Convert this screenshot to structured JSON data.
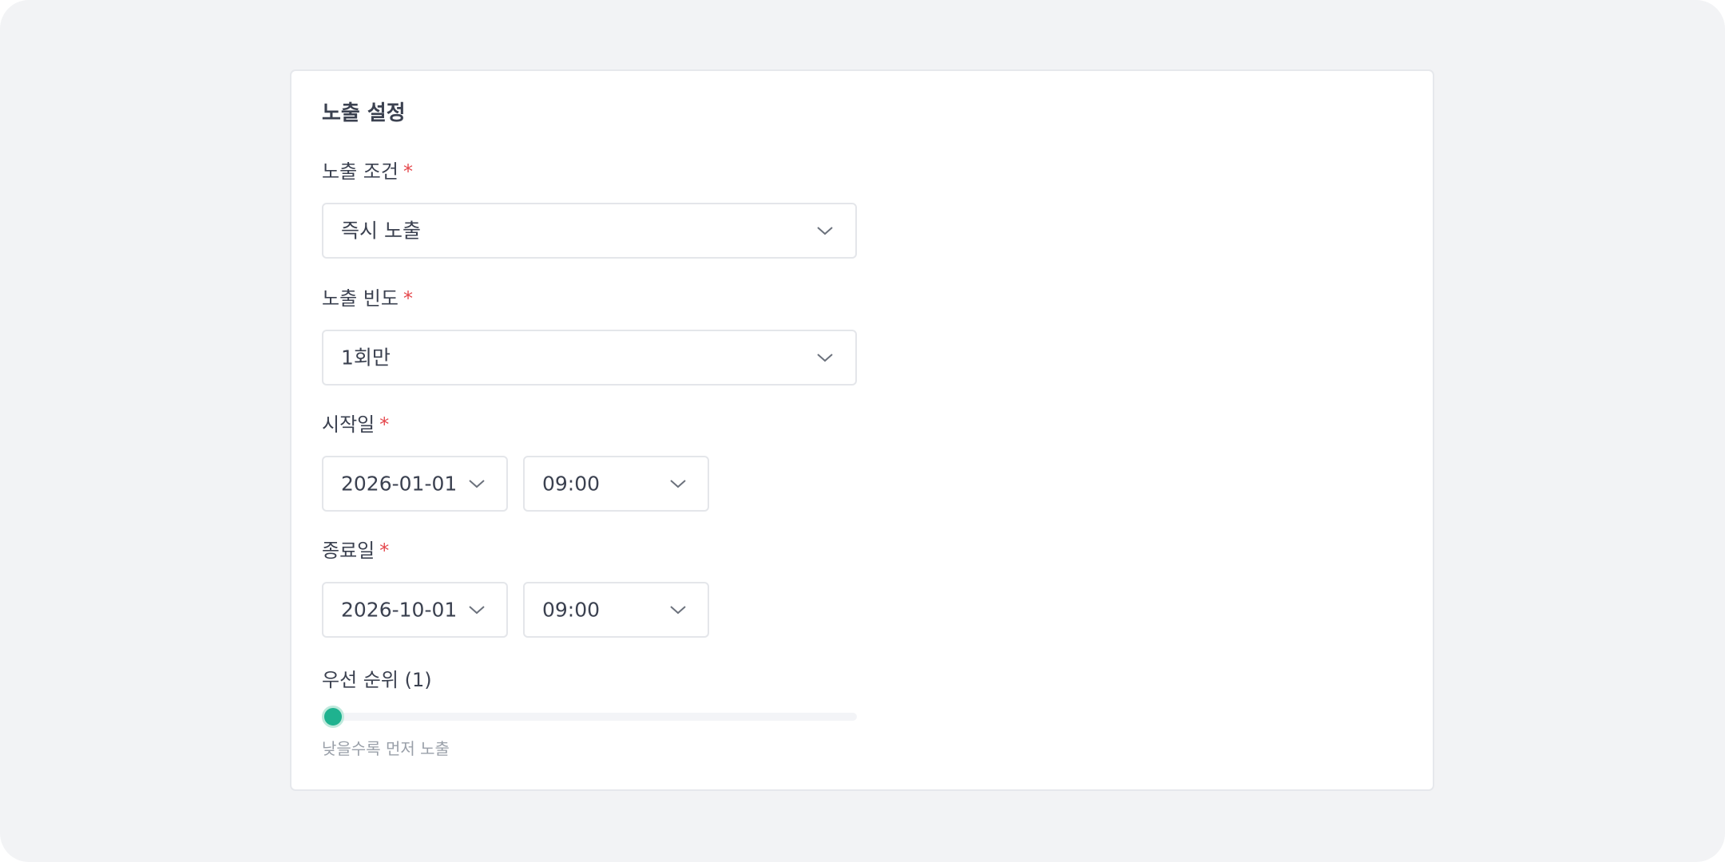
{
  "section": {
    "title": "노출 설정"
  },
  "fields": {
    "condition": {
      "label": "노출 조건",
      "required_mark": "*",
      "value": "즉시 노출"
    },
    "frequency": {
      "label": "노출 빈도",
      "required_mark": "*",
      "value": "1회만"
    },
    "start": {
      "label": "시작일",
      "required_mark": "*",
      "date": "2026-01-01",
      "time": "09:00"
    },
    "end": {
      "label": "종료일",
      "required_mark": "*",
      "date": "2026-10-01",
      "time": "09:00"
    },
    "priority": {
      "label": "우선 순위 (1)",
      "value": 1,
      "hint": "낮을수록 먼저 노출"
    }
  },
  "colors": {
    "accent": "#1fb28f",
    "required": "#e5484d",
    "background": "#f2f3f5"
  },
  "icons": {
    "dropdown": "chevron-down-icon"
  }
}
